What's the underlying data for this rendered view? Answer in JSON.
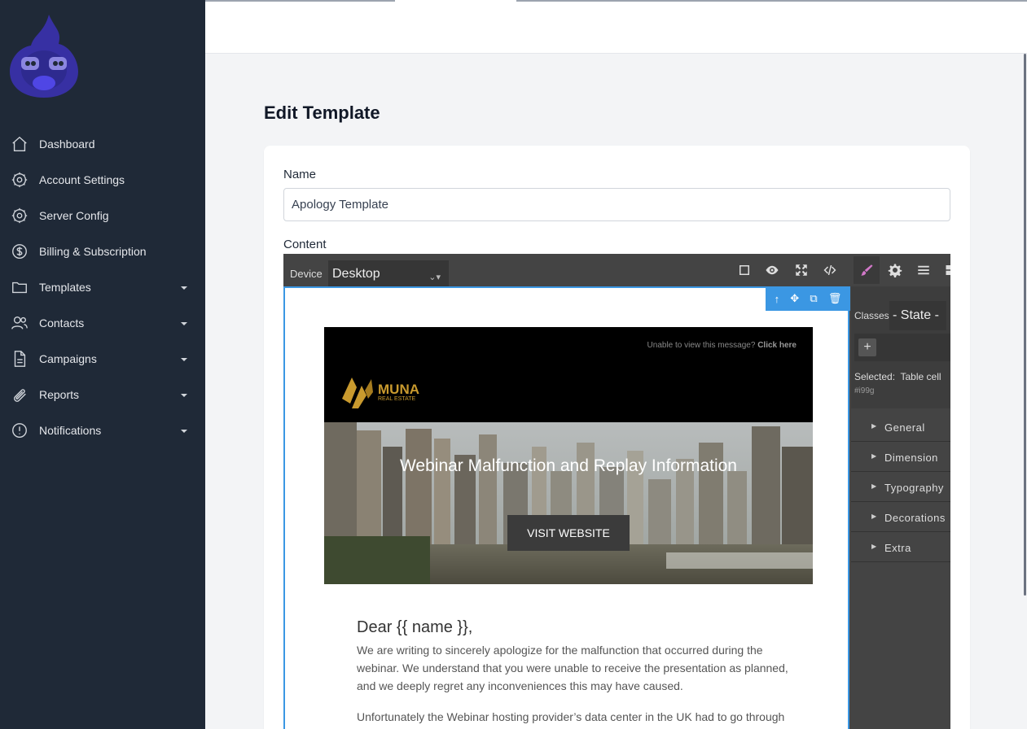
{
  "sidebar": {
    "items": [
      {
        "label": "Dashboard",
        "icon": "home-icon",
        "expandable": false
      },
      {
        "label": "Account Settings",
        "icon": "gear-icon",
        "expandable": false
      },
      {
        "label": "Server Config",
        "icon": "gear-icon",
        "expandable": false
      },
      {
        "label": "Billing & Subscription",
        "icon": "dollar-icon",
        "expandable": false
      },
      {
        "label": "Templates",
        "icon": "folder-icon",
        "expandable": true
      },
      {
        "label": "Contacts",
        "icon": "users-icon",
        "expandable": true
      },
      {
        "label": "Campaigns",
        "icon": "document-icon",
        "expandable": true
      },
      {
        "label": "Reports",
        "icon": "paperclip-icon",
        "expandable": true
      },
      {
        "label": "Notifications",
        "icon": "alert-icon",
        "expandable": true
      }
    ]
  },
  "page": {
    "title": "Edit Template",
    "name_label": "Name",
    "name_value": "Apology Template",
    "content_label": "Content"
  },
  "editor": {
    "device_label": "Device",
    "device_value": "Desktop",
    "toolbar_icons": [
      "square-outline-icon",
      "eye-icon",
      "fullscreen-icon",
      "code-icon",
      "paintbrush-icon",
      "settings-icon",
      "layers-icon",
      "blocks-icon"
    ],
    "selection_toolbar": [
      "arrow-up-icon",
      "move-icon",
      "copy-icon",
      "trash-icon"
    ]
  },
  "email": {
    "unable_text": "Unable to view this message?",
    "click_here": "Click here",
    "brand_name": "MUNA",
    "brand_sub": "REAL ESTATE",
    "hero_title": "Webinar Malfunction and Replay Information",
    "cta_label": "VISIT WEBSITE",
    "greeting": "Dear {{ name }},",
    "paragraph1": "We are writing to sincerely apologize for the malfunction that occurred during the webinar. We understand that you were unable to receive the presentation as planned, and we deeply regret any inconveniences this may have caused.",
    "paragraph2": "Unfortunately the Webinar hosting provider’s data center in the UK had to go through an unexpected emergency maintenance procedure yesterday due to some circumstances beyond their control which resulted to the downtime of the webinar’s"
  },
  "style_panel": {
    "classes_label": "Classes",
    "state_value": "- State -",
    "add_label": "+",
    "selected_label": "Selected:",
    "selected_value": "Table cell",
    "selected_id": "#i99g",
    "sectors": [
      "General",
      "Dimension",
      "Typography",
      "Decorations",
      "Extra"
    ]
  },
  "colors": {
    "sidebar_bg": "#1f2937",
    "logo_color": "#3730a3",
    "selection_blue": "#3b97e3",
    "brand_gold": "#c99a2e",
    "editor_dark": "#444444"
  }
}
